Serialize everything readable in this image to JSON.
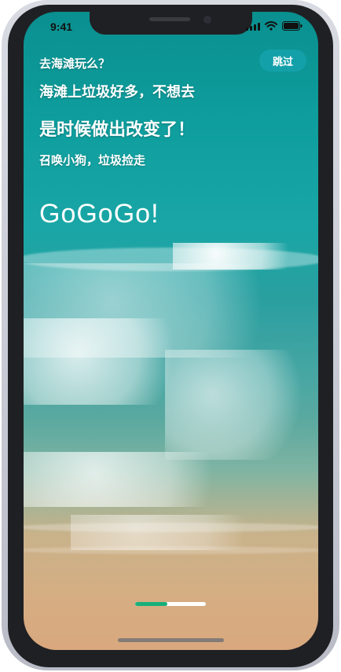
{
  "status_bar": {
    "time": "9:41"
  },
  "skip": {
    "label": "跳过"
  },
  "intro": {
    "line1": "去海滩玩么？",
    "line2": "海滩上垃圾好多，不想去",
    "line3": "是时候做出改变了！",
    "line4": "召唤小狗，垃圾捡走"
  },
  "brand": {
    "text": "GoGoGo!"
  },
  "pagination": {
    "current_progress": 0.45
  },
  "icons": [
    "signal-icon",
    "wifi-icon",
    "battery-icon"
  ],
  "colors": {
    "skip_bg": "#14a0aa",
    "indicator_active": "#19b07a",
    "indicator_inactive": "#ffffff"
  }
}
